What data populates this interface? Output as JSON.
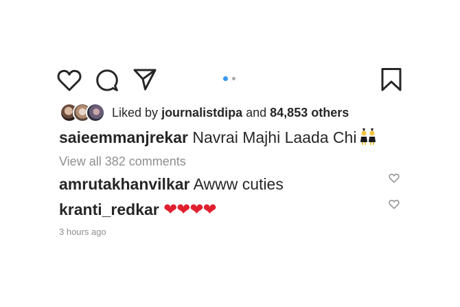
{
  "actions": {
    "like_icon": "heart-outline-icon",
    "comment_icon": "comment-bubble-icon",
    "share_icon": "paper-plane-icon",
    "save_icon": "bookmark-icon",
    "carousel_count": 2,
    "carousel_active_index": 0,
    "accent_color": "#3897f0"
  },
  "likes": {
    "prefix": "Liked by",
    "user": "journalistdipa",
    "joiner": "and",
    "count_text": "84,853 others"
  },
  "caption": {
    "username": "saieemmanjrekar",
    "text": "Navrai Majhi Laada Chi",
    "emoji": "👯"
  },
  "view_all_comments": "View all 382 comments",
  "comments": [
    {
      "username": "amrutakhanvilkar",
      "text": "Awww cuties"
    },
    {
      "username": "kranti_redkar",
      "text": "❤❤❤❤"
    }
  ],
  "timestamp": "3 hours ago"
}
